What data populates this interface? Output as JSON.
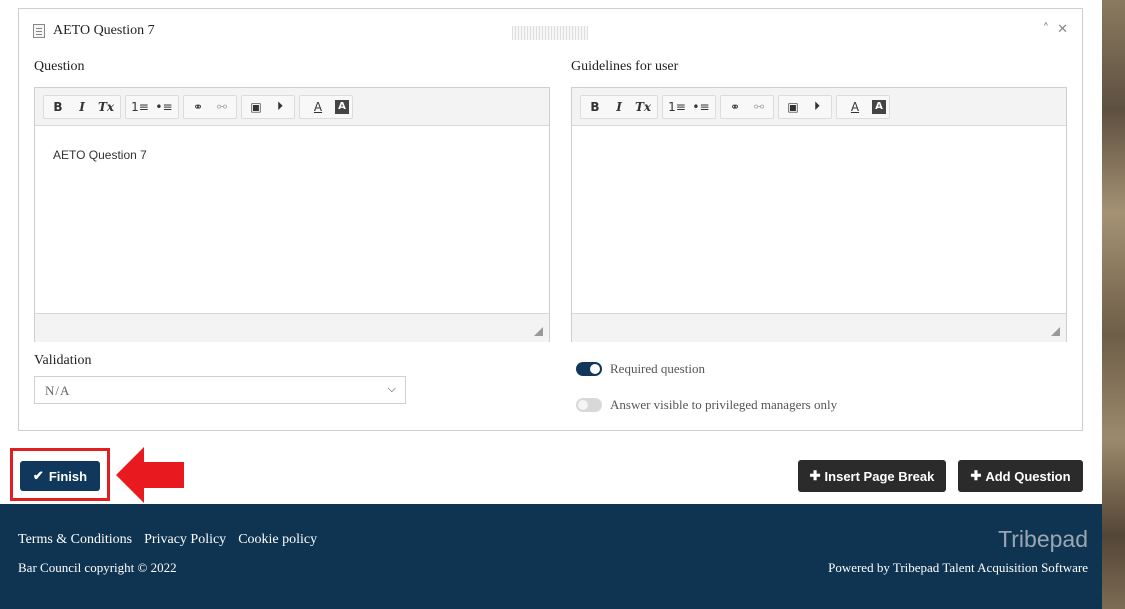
{
  "panel": {
    "title": "AETO Question 7",
    "collapse_icon": "chevron-double-up-icon",
    "close_icon": "close-icon"
  },
  "question": {
    "label": "Question",
    "content": "AETO Question 7"
  },
  "guidelines": {
    "label": "Guidelines for user",
    "content": ""
  },
  "toolbar": {
    "bold": "B",
    "italic": "I",
    "remove_format": "Tx",
    "numbered_list": "1≡",
    "bulleted_list": "•≡",
    "link": "⚭",
    "unlink": "⚯",
    "image": "▣",
    "media": "⏵",
    "text_color": "A",
    "bg_color": "A"
  },
  "validation": {
    "label": "Validation",
    "selected": "N/A"
  },
  "toggles": {
    "required_label": "Required question",
    "required_on": true,
    "privileged_label": "Answer visible to privileged managers only",
    "privileged_on": false
  },
  "actions": {
    "finish": "Finish",
    "insert_page_break": "Insert Page Break",
    "add_question": "Add Question"
  },
  "footer": {
    "terms": "Terms & Conditions",
    "privacy": "Privacy Policy",
    "cookie": "Cookie policy",
    "copyright": "Bar Council copyright © 2022",
    "brand": "Tribepad",
    "powered_by": "Powered by Tribepad Talent Acquisition Software"
  },
  "colors": {
    "primary": "#10375c",
    "footer_bg": "#0e3452",
    "dark_button": "#2b2b2b",
    "highlight": "#e02020"
  }
}
